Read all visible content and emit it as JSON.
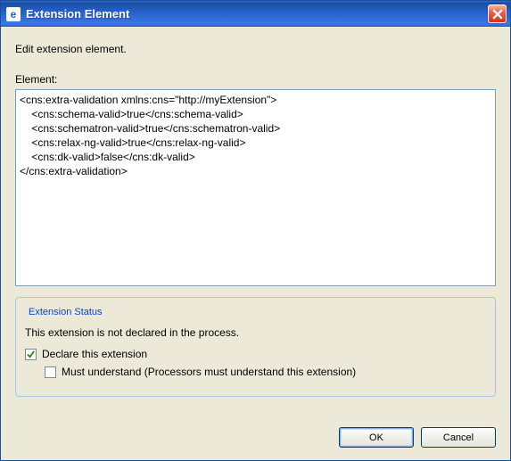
{
  "window": {
    "title": "Extension Element"
  },
  "instruction": "Edit extension element.",
  "element": {
    "label": "Element:",
    "value": "<cns:extra-validation xmlns:cns=\"http://myExtension\">\n    <cns:schema-valid>true</cns:schema-valid>\n    <cns:schematron-valid>true</cns:schematron-valid>\n    <cns:relax-ng-valid>true</cns:relax-ng-valid>\n    <cns:dk-valid>false</cns:dk-valid>\n</cns:extra-validation>"
  },
  "status": {
    "legend": "Extension Status",
    "text": "This extension is not declared in the process.",
    "declare": {
      "label": "Declare this extension",
      "checked": true
    },
    "mustUnderstand": {
      "label": "Must understand (Processors must understand this extension)",
      "checked": false
    }
  },
  "buttons": {
    "ok": "OK",
    "cancel": "Cancel"
  }
}
